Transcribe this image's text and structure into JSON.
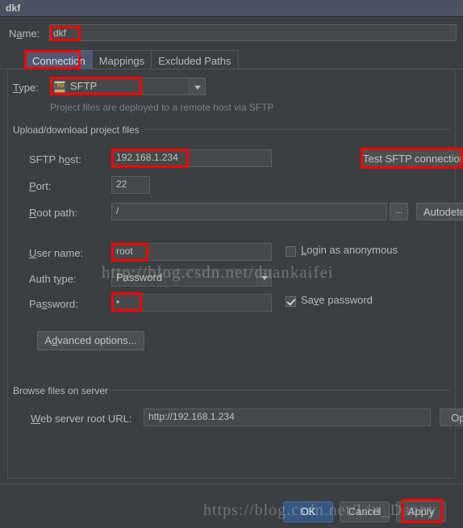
{
  "window": {
    "title": "dkf"
  },
  "name_row": {
    "label": "Name:",
    "value": "dkf"
  },
  "tabs": [
    {
      "label": "Connection",
      "active": true
    },
    {
      "label": "Mappings",
      "active": false
    },
    {
      "label": "Excluded Paths",
      "active": false
    }
  ],
  "type_row": {
    "label": "Type:",
    "value": "SFTP",
    "icon": "ftp-server-icon",
    "hint": "Project files are deployed to a remote host via SFTP"
  },
  "group_upload": {
    "title": "Upload/download project files",
    "host": {
      "label": "SFTP host:",
      "value": "192.168.1.234"
    },
    "test_button": "Test SFTP connection...",
    "port": {
      "label": "Port:",
      "value": "22"
    },
    "root_path": {
      "label": "Root path:",
      "value": "/"
    },
    "browse_button": "...",
    "autodetect_button": "Autodetect",
    "user_name": {
      "label": "User name:",
      "value": "root"
    },
    "login_anonymous": {
      "label": "Login as anonymous",
      "checked": false
    },
    "auth_type": {
      "label": "Auth type:",
      "value": "Password"
    },
    "password": {
      "label": "Password:",
      "value": "•"
    },
    "save_password": {
      "label": "Save password",
      "checked": true
    },
    "advanced_button": "Advanced options..."
  },
  "group_browse": {
    "title": "Browse files on server",
    "web_url": {
      "label": "Web server root URL:",
      "value": "http://192.168.1.234"
    },
    "open_button": "Open"
  },
  "footer": {
    "ok": "OK",
    "cancel": "Cancel",
    "apply": "Apply"
  },
  "watermarks": {
    "line1": "http://blog.csdn.net/duankaifei",
    "line2": "https://blog.csdn.net/Lin_Danny"
  },
  "colors": {
    "background": "#3c3f41",
    "titlebar": "#4c5262",
    "field": "#45494a",
    "accent_tab": "#4e5a73",
    "ok_button": "#365880",
    "annotation": "#ff0000"
  }
}
